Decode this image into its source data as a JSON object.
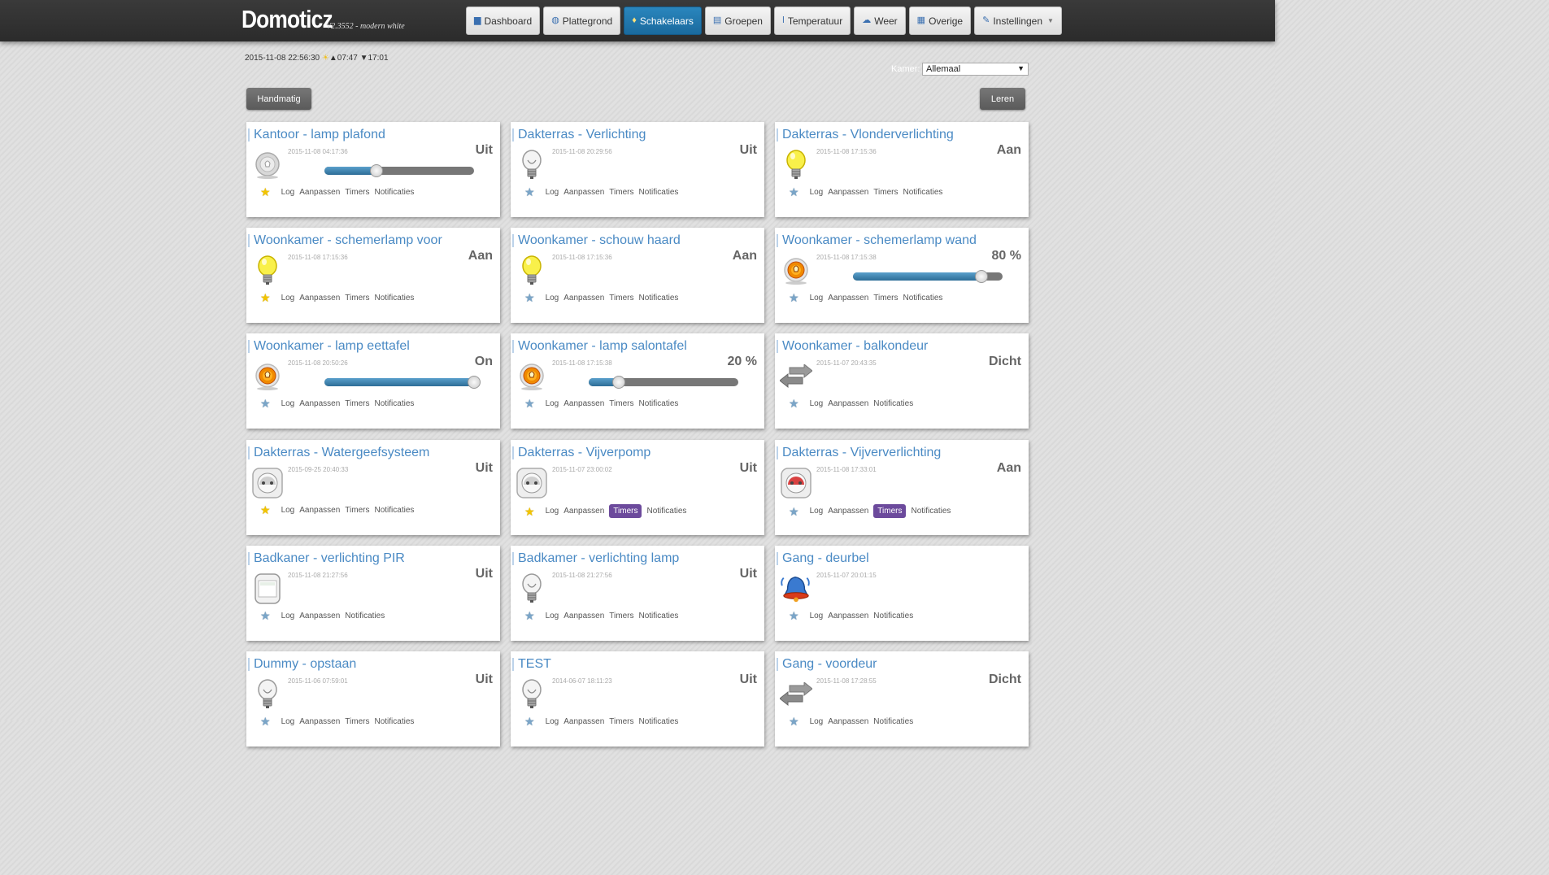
{
  "header": {
    "brand": "Domoticz",
    "version": "V2.3552 - modern white",
    "nav": [
      {
        "icon": "dashboard-icon",
        "glyph": "▆",
        "label": "Dashboard",
        "active": false,
        "caret": false
      },
      {
        "icon": "floorplan-icon",
        "glyph": "◍",
        "label": "Plattegrond",
        "active": false,
        "caret": false
      },
      {
        "icon": "switch-icon",
        "glyph": "♦",
        "label": "Schakelaars",
        "active": true,
        "caret": false
      },
      {
        "icon": "groups-icon",
        "glyph": "▤",
        "label": "Groepen",
        "active": false,
        "caret": false
      },
      {
        "icon": "thermometer-icon",
        "glyph": "ǀ",
        "label": "Temperatuur",
        "active": false,
        "caret": false
      },
      {
        "icon": "weather-icon",
        "glyph": "☁",
        "label": "Weer",
        "active": false,
        "caret": false
      },
      {
        "icon": "utility-icon",
        "glyph": "▦",
        "label": "Overige",
        "active": false,
        "caret": false
      },
      {
        "icon": "settings-icon",
        "glyph": "✎",
        "label": "Instellingen",
        "active": false,
        "caret": true
      }
    ]
  },
  "status": {
    "datetime": "2015-11-08 22:56:30",
    "sunrise": "▲07:47",
    "sunset": "▼17:01"
  },
  "room_filter": {
    "label": "Kamer:",
    "value": "Allemaal"
  },
  "buttons": {
    "manual": "Handmatig",
    "learn": "Leren"
  },
  "colors": {
    "accent": "#2a86bd",
    "title": "#4a8ac4",
    "timers_badge": "#6c4a9c"
  },
  "devices": [
    {
      "title": "Kantoor - lamp plafond",
      "time": "2015-11-08 04:17:36",
      "status": "Uit",
      "icon": "bulb-off-grey-icon",
      "dimmer": 0.35,
      "favorite": true,
      "links": [
        "Log",
        "Aanpassen",
        "Timers",
        "Notificaties"
      ],
      "badge": ""
    },
    {
      "title": "Dakterras - Verlichting",
      "time": "2015-11-08 20:29:56",
      "status": "Uit",
      "icon": "bulb-off-icon",
      "favorite": false,
      "links": [
        "Log",
        "Aanpassen",
        "Timers",
        "Notificaties"
      ],
      "badge": ""
    },
    {
      "title": "Dakterras - Vlonderverlichting",
      "time": "2015-11-08 17:15:36",
      "status": "Aan",
      "icon": "bulb-on-icon",
      "favorite": false,
      "links": [
        "Log",
        "Aanpassen",
        "Timers",
        "Notificaties"
      ],
      "badge": ""
    },
    {
      "title": "Woonkamer - schemerlamp voor",
      "time": "2015-11-08 17:15:36",
      "status": "Aan",
      "icon": "bulb-on-icon",
      "favorite": true,
      "links": [
        "Log",
        "Aanpassen",
        "Timers",
        "Notificaties"
      ],
      "badge": ""
    },
    {
      "title": "Woonkamer - schouw haard",
      "time": "2015-11-08 17:15:36",
      "status": "Aan",
      "icon": "bulb-on-icon",
      "favorite": false,
      "links": [
        "Log",
        "Aanpassen",
        "Timers",
        "Notificaties"
      ],
      "badge": ""
    },
    {
      "title": "Woonkamer - schemerlamp wand",
      "time": "2015-11-08 17:15:38",
      "status": "80 %",
      "icon": "dimmer-on-icon",
      "dimmer": 0.86,
      "favorite": false,
      "links": [
        "Log",
        "Aanpassen",
        "Timers",
        "Notificaties"
      ],
      "badge": ""
    },
    {
      "title": "Woonkamer - lamp eettafel",
      "time": "2015-11-08 20:50:26",
      "status": "On",
      "icon": "dimmer-on-icon",
      "dimmer": 1.0,
      "favorite": false,
      "links": [
        "Log",
        "Aanpassen",
        "Timers",
        "Notificaties"
      ],
      "badge": ""
    },
    {
      "title": "Woonkamer - lamp salontafel",
      "time": "2015-11-08 17:15:38",
      "status": "20 %",
      "icon": "dimmer-on-icon",
      "dimmer": 0.2,
      "favorite": false,
      "links": [
        "Log",
        "Aanpassen",
        "Timers",
        "Notificaties"
      ],
      "badge": ""
    },
    {
      "title": "Woonkamer - balkondeur",
      "time": "2015-11-07 20:43:35",
      "status": "Dicht",
      "icon": "door-arrows-icon",
      "favorite": false,
      "links": [
        "Log",
        "Aanpassen",
        "Notificaties"
      ],
      "badge": ""
    },
    {
      "title": "Dakterras - Watergeefsysteem",
      "time": "2015-09-25 20:40:33",
      "status": "Uit",
      "icon": "socket-off-icon",
      "favorite": true,
      "links": [
        "Log",
        "Aanpassen",
        "Timers",
        "Notificaties"
      ],
      "badge": ""
    },
    {
      "title": "Dakterras - Vijverpomp",
      "time": "2015-11-07 23:00:02",
      "status": "Uit",
      "icon": "socket-off-icon",
      "favorite": true,
      "links": [
        "Log",
        "Aanpassen",
        "Timers",
        "Notificaties"
      ],
      "badge": "Timers"
    },
    {
      "title": "Dakterras - Vijververlichting",
      "time": "2015-11-08 17:33:01",
      "status": "Aan",
      "icon": "socket-on-icon",
      "favorite": false,
      "links": [
        "Log",
        "Aanpassen",
        "Timers",
        "Notificaties"
      ],
      "badge": "Timers"
    },
    {
      "title": "Badkaner - verlichting PIR",
      "time": "2015-11-08 21:27:56",
      "status": "Uit",
      "icon": "pir-sensor-icon",
      "favorite": false,
      "links": [
        "Log",
        "Aanpassen",
        "Notificaties"
      ],
      "badge": ""
    },
    {
      "title": "Badkamer - verlichting lamp",
      "time": "2015-11-08 21:27:56",
      "status": "Uit",
      "icon": "bulb-off-icon",
      "favorite": false,
      "links": [
        "Log",
        "Aanpassen",
        "Timers",
        "Notificaties"
      ],
      "badge": ""
    },
    {
      "title": "Gang - deurbel",
      "time": "2015-11-07 20:01:15",
      "status": "",
      "icon": "doorbell-icon",
      "favorite": false,
      "links": [
        "Log",
        "Aanpassen",
        "Notificaties"
      ],
      "badge": ""
    },
    {
      "title": "Dummy - opstaan",
      "time": "2015-11-06 07:59:01",
      "status": "Uit",
      "icon": "bulb-off-icon",
      "favorite": false,
      "links": [
        "Log",
        "Aanpassen",
        "Timers",
        "Notificaties"
      ],
      "badge": ""
    },
    {
      "title": "TEST",
      "time": "2014-06-07 18:11:23",
      "status": "Uit",
      "icon": "bulb-off-icon",
      "favorite": false,
      "links": [
        "Log",
        "Aanpassen",
        "Timers",
        "Notificaties"
      ],
      "badge": ""
    },
    {
      "title": "Gang - voordeur",
      "time": "2015-11-08 17:28:55",
      "status": "Dicht",
      "icon": "door-arrows-icon",
      "favorite": false,
      "links": [
        "Log",
        "Aanpassen",
        "Notificaties"
      ],
      "badge": ""
    }
  ]
}
